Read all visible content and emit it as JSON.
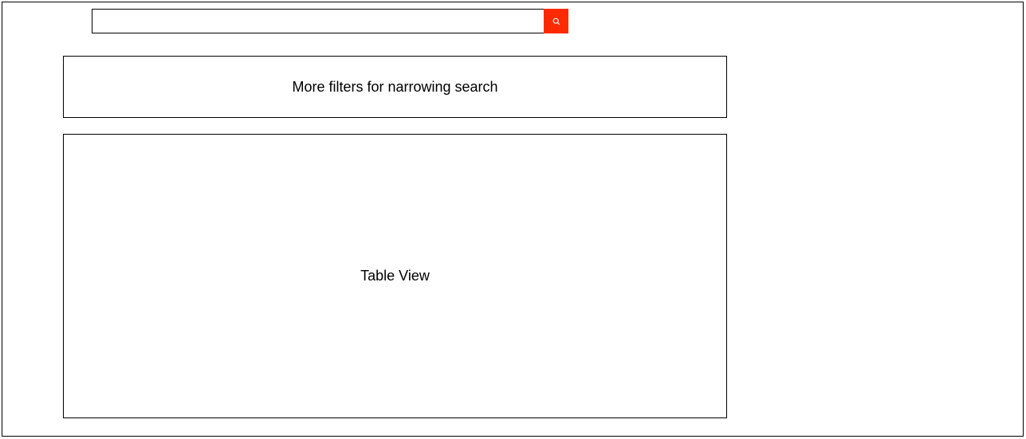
{
  "colors": {
    "accent": "#ff2a00",
    "border": "#000000",
    "background": "#ffffff"
  },
  "search": {
    "value": "",
    "placeholder": "",
    "button_icon": "search-icon"
  },
  "filters_panel": {
    "label": "More filters for narrowing search"
  },
  "table_panel": {
    "label": "Table View"
  }
}
